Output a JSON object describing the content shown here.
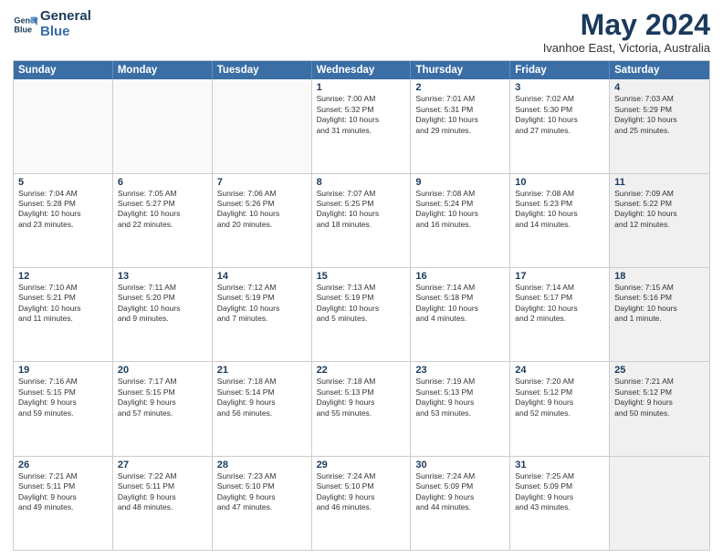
{
  "header": {
    "logo_line1": "General",
    "logo_line2": "Blue",
    "month": "May 2024",
    "location": "Ivanhoe East, Victoria, Australia"
  },
  "days_of_week": [
    "Sunday",
    "Monday",
    "Tuesday",
    "Wednesday",
    "Thursday",
    "Friday",
    "Saturday"
  ],
  "weeks": [
    [
      {
        "day": "",
        "text": "",
        "empty": true
      },
      {
        "day": "",
        "text": "",
        "empty": true
      },
      {
        "day": "",
        "text": "",
        "empty": true
      },
      {
        "day": "1",
        "text": "Sunrise: 7:00 AM\nSunset: 5:32 PM\nDaylight: 10 hours\nand 31 minutes."
      },
      {
        "day": "2",
        "text": "Sunrise: 7:01 AM\nSunset: 5:31 PM\nDaylight: 10 hours\nand 29 minutes."
      },
      {
        "day": "3",
        "text": "Sunrise: 7:02 AM\nSunset: 5:30 PM\nDaylight: 10 hours\nand 27 minutes."
      },
      {
        "day": "4",
        "text": "Sunrise: 7:03 AM\nSunset: 5:29 PM\nDaylight: 10 hours\nand 25 minutes.",
        "shaded": true
      }
    ],
    [
      {
        "day": "5",
        "text": "Sunrise: 7:04 AM\nSunset: 5:28 PM\nDaylight: 10 hours\nand 23 minutes."
      },
      {
        "day": "6",
        "text": "Sunrise: 7:05 AM\nSunset: 5:27 PM\nDaylight: 10 hours\nand 22 minutes."
      },
      {
        "day": "7",
        "text": "Sunrise: 7:06 AM\nSunset: 5:26 PM\nDaylight: 10 hours\nand 20 minutes."
      },
      {
        "day": "8",
        "text": "Sunrise: 7:07 AM\nSunset: 5:25 PM\nDaylight: 10 hours\nand 18 minutes."
      },
      {
        "day": "9",
        "text": "Sunrise: 7:08 AM\nSunset: 5:24 PM\nDaylight: 10 hours\nand 16 minutes."
      },
      {
        "day": "10",
        "text": "Sunrise: 7:08 AM\nSunset: 5:23 PM\nDaylight: 10 hours\nand 14 minutes."
      },
      {
        "day": "11",
        "text": "Sunrise: 7:09 AM\nSunset: 5:22 PM\nDaylight: 10 hours\nand 12 minutes.",
        "shaded": true
      }
    ],
    [
      {
        "day": "12",
        "text": "Sunrise: 7:10 AM\nSunset: 5:21 PM\nDaylight: 10 hours\nand 11 minutes."
      },
      {
        "day": "13",
        "text": "Sunrise: 7:11 AM\nSunset: 5:20 PM\nDaylight: 10 hours\nand 9 minutes."
      },
      {
        "day": "14",
        "text": "Sunrise: 7:12 AM\nSunset: 5:19 PM\nDaylight: 10 hours\nand 7 minutes."
      },
      {
        "day": "15",
        "text": "Sunrise: 7:13 AM\nSunset: 5:19 PM\nDaylight: 10 hours\nand 5 minutes."
      },
      {
        "day": "16",
        "text": "Sunrise: 7:14 AM\nSunset: 5:18 PM\nDaylight: 10 hours\nand 4 minutes."
      },
      {
        "day": "17",
        "text": "Sunrise: 7:14 AM\nSunset: 5:17 PM\nDaylight: 10 hours\nand 2 minutes."
      },
      {
        "day": "18",
        "text": "Sunrise: 7:15 AM\nSunset: 5:16 PM\nDaylight: 10 hours\nand 1 minute.",
        "shaded": true
      }
    ],
    [
      {
        "day": "19",
        "text": "Sunrise: 7:16 AM\nSunset: 5:15 PM\nDaylight: 9 hours\nand 59 minutes."
      },
      {
        "day": "20",
        "text": "Sunrise: 7:17 AM\nSunset: 5:15 PM\nDaylight: 9 hours\nand 57 minutes."
      },
      {
        "day": "21",
        "text": "Sunrise: 7:18 AM\nSunset: 5:14 PM\nDaylight: 9 hours\nand 56 minutes."
      },
      {
        "day": "22",
        "text": "Sunrise: 7:18 AM\nSunset: 5:13 PM\nDaylight: 9 hours\nand 55 minutes."
      },
      {
        "day": "23",
        "text": "Sunrise: 7:19 AM\nSunset: 5:13 PM\nDaylight: 9 hours\nand 53 minutes."
      },
      {
        "day": "24",
        "text": "Sunrise: 7:20 AM\nSunset: 5:12 PM\nDaylight: 9 hours\nand 52 minutes."
      },
      {
        "day": "25",
        "text": "Sunrise: 7:21 AM\nSunset: 5:12 PM\nDaylight: 9 hours\nand 50 minutes.",
        "shaded": true
      }
    ],
    [
      {
        "day": "26",
        "text": "Sunrise: 7:21 AM\nSunset: 5:11 PM\nDaylight: 9 hours\nand 49 minutes."
      },
      {
        "day": "27",
        "text": "Sunrise: 7:22 AM\nSunset: 5:11 PM\nDaylight: 9 hours\nand 48 minutes."
      },
      {
        "day": "28",
        "text": "Sunrise: 7:23 AM\nSunset: 5:10 PM\nDaylight: 9 hours\nand 47 minutes."
      },
      {
        "day": "29",
        "text": "Sunrise: 7:24 AM\nSunset: 5:10 PM\nDaylight: 9 hours\nand 46 minutes."
      },
      {
        "day": "30",
        "text": "Sunrise: 7:24 AM\nSunset: 5:09 PM\nDaylight: 9 hours\nand 44 minutes."
      },
      {
        "day": "31",
        "text": "Sunrise: 7:25 AM\nSunset: 5:09 PM\nDaylight: 9 hours\nand 43 minutes."
      },
      {
        "day": "",
        "text": "",
        "empty": true,
        "shaded": true
      }
    ]
  ]
}
